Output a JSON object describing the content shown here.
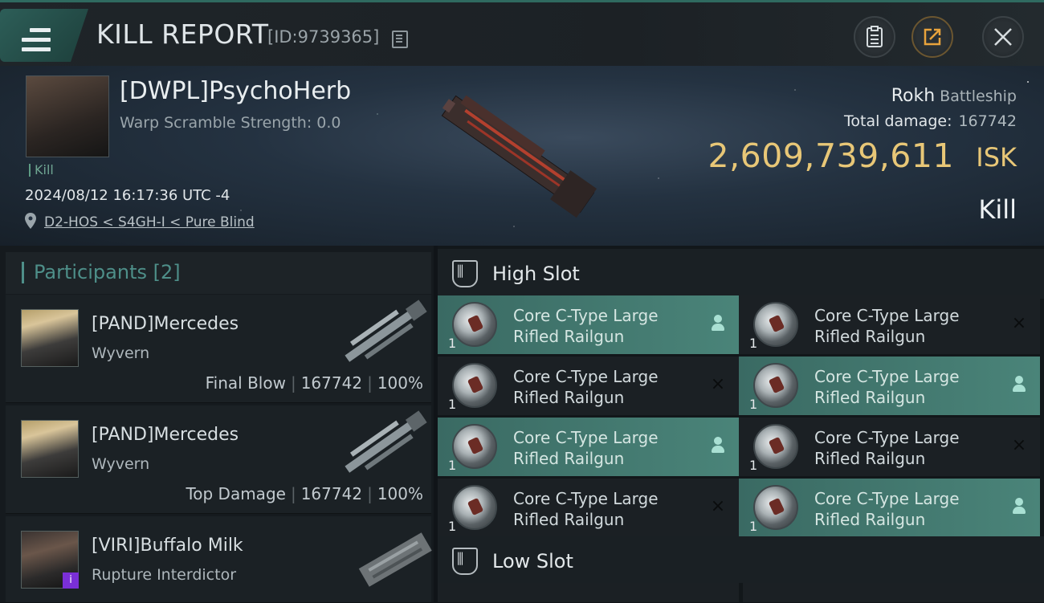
{
  "header": {
    "title": "KILL REPORT",
    "report_id": "[ID:9739365]"
  },
  "victim": {
    "name": "[DWPL]PsychoHerb",
    "warp_scramble": "Warp Scramble Strength: 0.0",
    "tag": "Kill",
    "timestamp": "2024/08/12 16:17:36 UTC -4",
    "location": "D2-HOS < S4GH-I < Pure Blind",
    "ship_name": "Rokh",
    "ship_class": "Battleship",
    "total_damage_label": "Total damage:",
    "total_damage": "167742",
    "isk_value": "2,609,739,611",
    "isk_unit": "ISK",
    "result": "Kill"
  },
  "participants": {
    "title": "Participants",
    "count": "[2]",
    "items": [
      {
        "name": "[PAND]Mercedes",
        "ship": "Wyvern",
        "role": "Final Blow",
        "damage": "167742",
        "percent": "100%"
      },
      {
        "name": "[PAND]Mercedes",
        "ship": "Wyvern",
        "role": "Top Damage",
        "damage": "167742",
        "percent": "100%"
      },
      {
        "name": "[VIRI]Buffalo Milk",
        "ship": "Rupture Interdictor",
        "badge": "i"
      }
    ]
  },
  "slots": {
    "high_title": "High Slot",
    "low_title": "Low Slot",
    "high_modules": [
      {
        "line1": "Core C-Type Large",
        "line2": "Rifled Railgun",
        "qty": "1",
        "status": "fitted"
      },
      {
        "line1": "Core C-Type Large",
        "line2": "Rifled Railgun",
        "qty": "1",
        "status": "destroyed"
      },
      {
        "line1": "Core C-Type Large",
        "line2": "Rifled Railgun",
        "qty": "1",
        "status": "destroyed"
      },
      {
        "line1": "Core C-Type Large",
        "line2": "Rifled Railgun",
        "qty": "1",
        "status": "fitted"
      },
      {
        "line1": "Core C-Type Large",
        "line2": "Rifled Railgun",
        "qty": "1",
        "status": "fitted"
      },
      {
        "line1": "Core C-Type Large",
        "line2": "Rifled Railgun",
        "qty": "1",
        "status": "destroyed"
      },
      {
        "line1": "Core C-Type Large",
        "line2": "Rifled Railgun",
        "qty": "1",
        "status": "destroyed"
      },
      {
        "line1": "Core C-Type Large",
        "line2": "Rifled Railgun",
        "qty": "1",
        "status": "fitted"
      }
    ]
  },
  "icons": {
    "menu": "hamburger-icon",
    "clipboard": "clipboard-icon",
    "share": "share-icon",
    "close": "close-icon",
    "location": "location-pin-icon",
    "destroyed": "×"
  },
  "colors": {
    "accent": "#4e8f89",
    "isk": "#e8c777",
    "fitted": "#4a8479"
  }
}
